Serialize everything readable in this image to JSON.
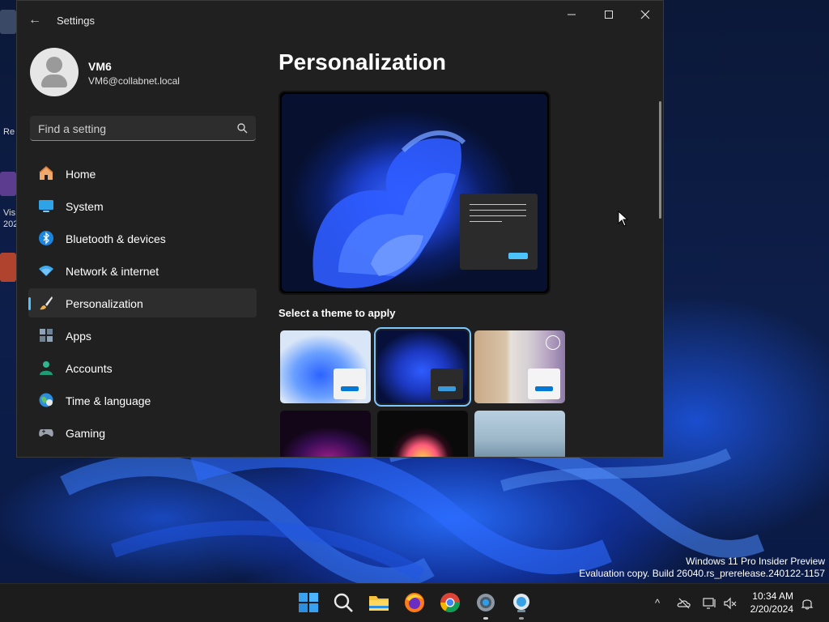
{
  "window": {
    "title": "Settings",
    "back_label": "←",
    "minimize_label": "—",
    "maximize_label": "☐",
    "close_label": "✕"
  },
  "profile": {
    "name": "VM6",
    "email": "VM6@collabnet.local"
  },
  "search": {
    "placeholder": "Find a setting"
  },
  "nav": {
    "items": [
      {
        "label": "Home",
        "icon": "home-icon"
      },
      {
        "label": "System",
        "icon": "system-icon"
      },
      {
        "label": "Bluetooth & devices",
        "icon": "bluetooth-icon"
      },
      {
        "label": "Network & internet",
        "icon": "wifi-icon"
      },
      {
        "label": "Personalization",
        "icon": "brush-icon",
        "selected": true
      },
      {
        "label": "Apps",
        "icon": "apps-icon"
      },
      {
        "label": "Accounts",
        "icon": "accounts-icon"
      },
      {
        "label": "Time & language",
        "icon": "globe-icon"
      },
      {
        "label": "Gaming",
        "icon": "gamepad-icon"
      }
    ]
  },
  "main": {
    "page_title": "Personalization",
    "section_label": "Select a theme to apply",
    "themes": [
      {
        "name": "windows-light-theme",
        "selected": false
      },
      {
        "name": "windows-dark-theme",
        "selected": true
      },
      {
        "name": "flowers-theme",
        "selected": false
      },
      {
        "name": "glow-theme",
        "selected": false
      },
      {
        "name": "captured-motion-theme",
        "selected": false
      },
      {
        "name": "sunrise-theme",
        "selected": false
      }
    ]
  },
  "desktop": {
    "edge_labels": [
      "Re",
      "Vis",
      "202"
    ],
    "watermark_line1": "Windows 11 Pro Insider Preview",
    "watermark_line2": "Evaluation copy. Build 26040.rs_prerelease.240122-1157"
  },
  "taskbar": {
    "pinned": [
      "start-icon",
      "search-icon",
      "file-explorer-icon",
      "firefox-icon",
      "chrome-icon",
      "settings-icon",
      "network-app-icon"
    ],
    "tray_chevron": "^",
    "time": "10:34 AM",
    "date": "2/20/2024"
  },
  "colors": {
    "accent": "#4cc2ff",
    "window_bg": "#202020",
    "selected_nav_bg": "#2d2d2d",
    "taskbar_bg": "#1c1c1c"
  }
}
